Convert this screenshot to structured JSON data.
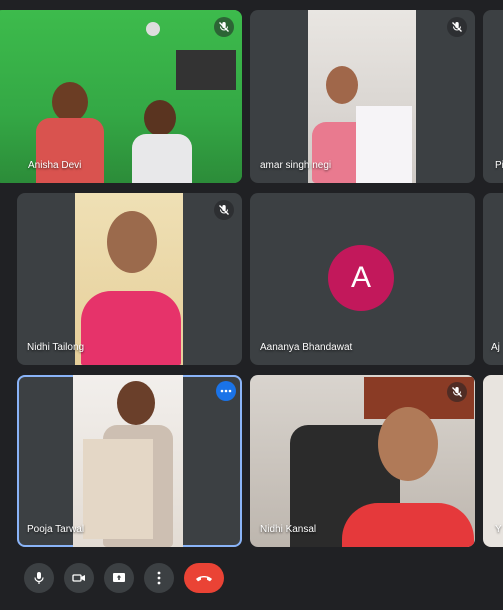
{
  "participants": [
    {
      "name": "Anisha Devi",
      "muted": true
    },
    {
      "name": "amar singh negi",
      "muted": true
    },
    {
      "name": "Pi"
    },
    {
      "name": "Nidhi Tailong",
      "muted": true
    },
    {
      "name": "Aananya Bhandawat",
      "avatar_letter": "A",
      "avatar_color": "#c2185b"
    },
    {
      "name": "Aj"
    },
    {
      "name": "Pooja Tarwal",
      "active_speaker": true
    },
    {
      "name": "Nidhi Kansal",
      "muted": true
    },
    {
      "name": "Y"
    }
  ],
  "controls": [
    {
      "icon": "microphone-icon"
    },
    {
      "icon": "camera-icon"
    },
    {
      "icon": "present-screen-icon"
    },
    {
      "icon": "more-options-icon"
    },
    {
      "icon": "end-call-icon",
      "color": "#ea4335"
    }
  ],
  "colors": {
    "background": "#202124",
    "tile": "#3c4043",
    "active_border": "#8ab4f8",
    "more_button": "#1a73e8"
  }
}
